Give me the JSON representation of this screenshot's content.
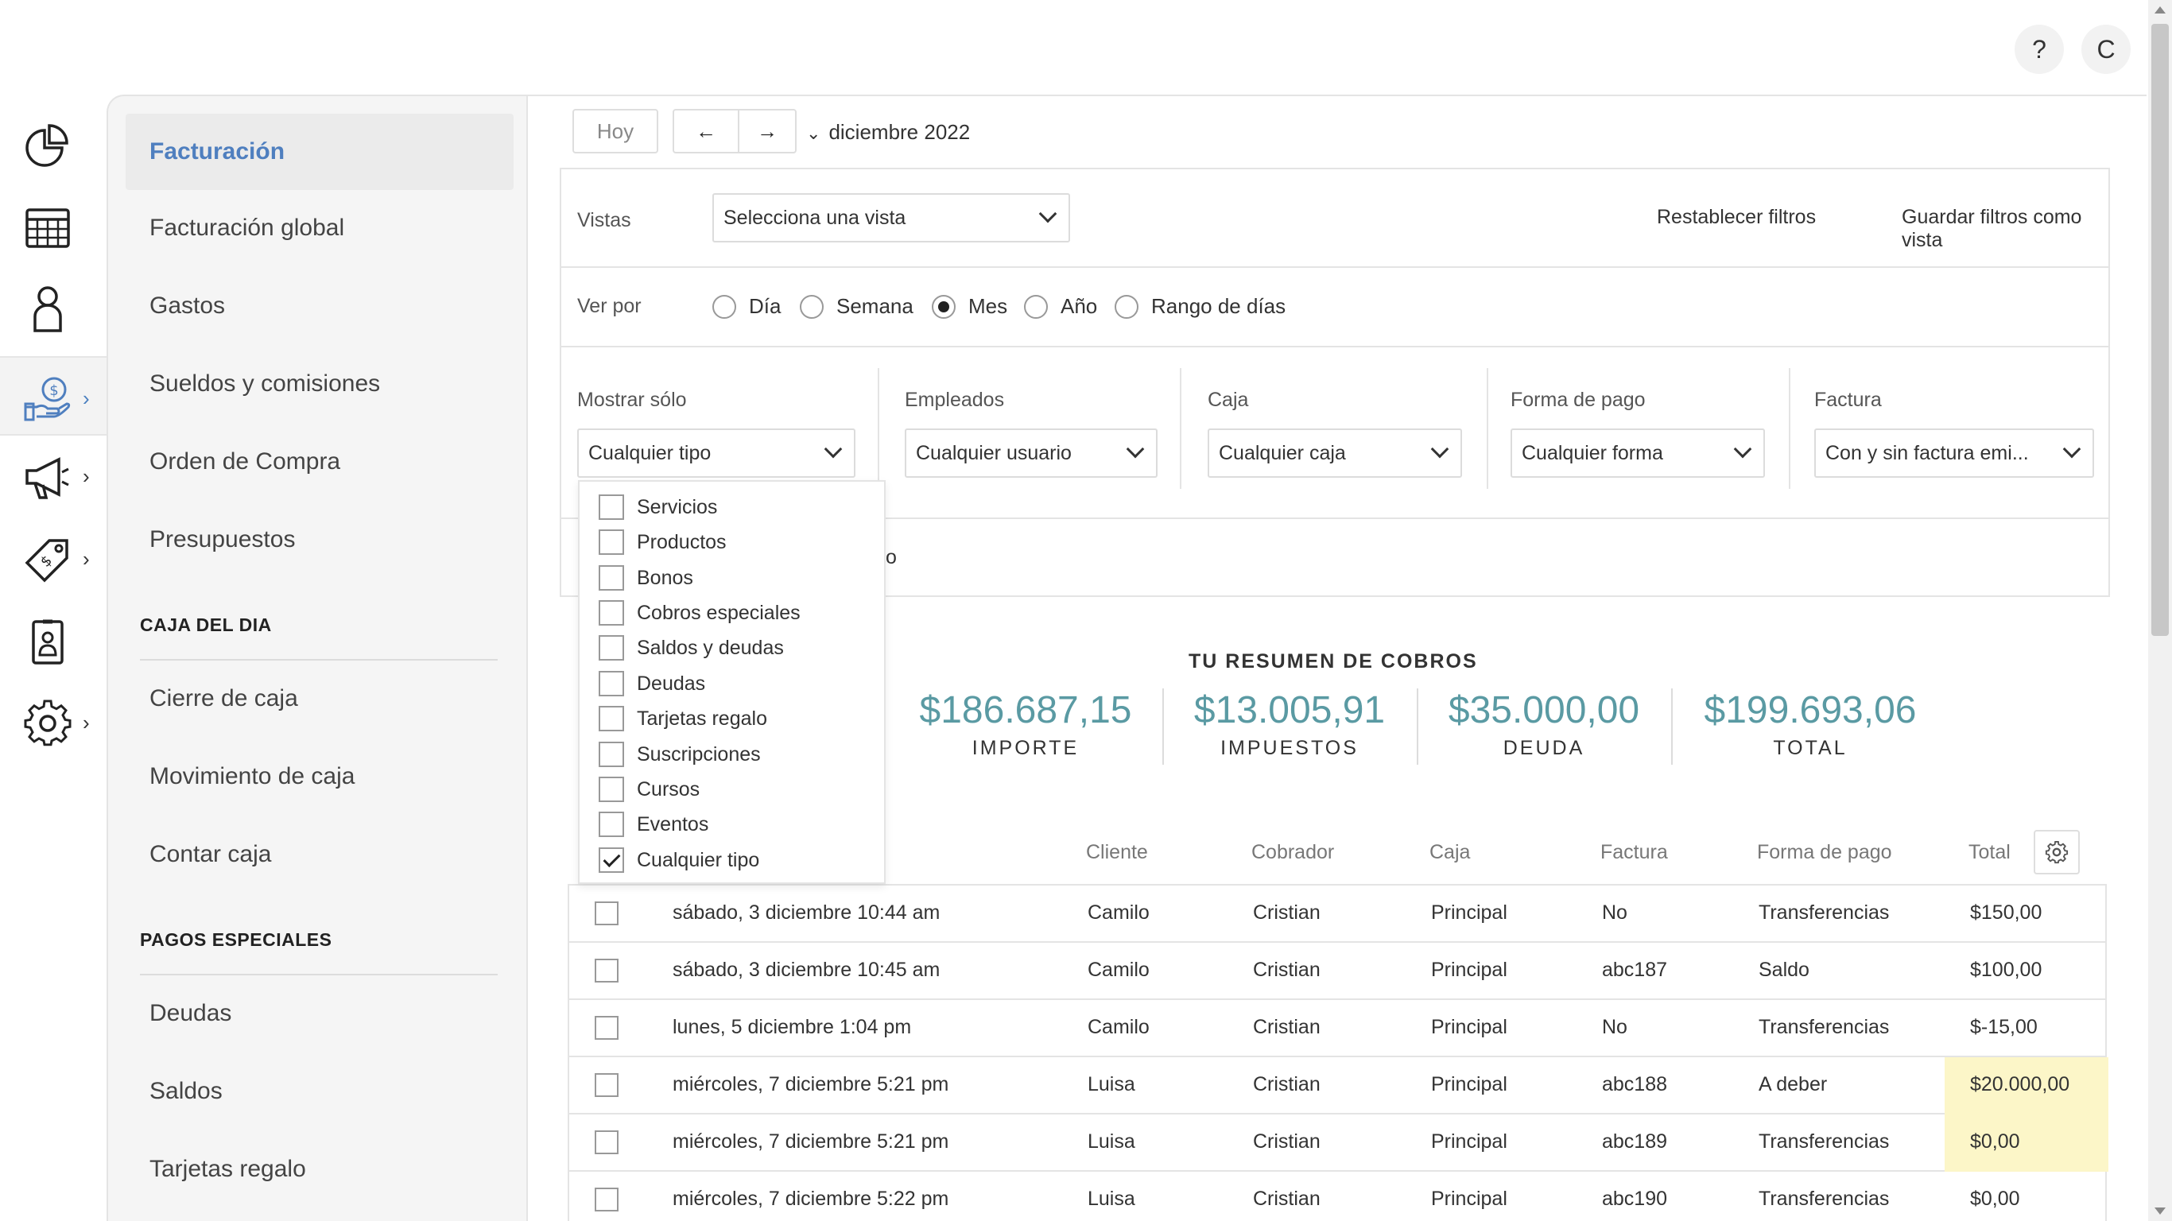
{
  "header": {
    "help_label": "?",
    "user_initial": "C"
  },
  "rail": {
    "items": [
      {
        "icon": "pie-chart-icon"
      },
      {
        "icon": "calendar-icon"
      },
      {
        "icon": "user-icon"
      },
      {
        "icon": "money-hand-icon",
        "active": true
      },
      {
        "icon": "megaphone-icon"
      },
      {
        "icon": "tag-icon"
      },
      {
        "icon": "badge-icon"
      },
      {
        "icon": "gear-icon"
      }
    ],
    "chevron": "›"
  },
  "sidebar": {
    "items": [
      {
        "label": "Facturación"
      },
      {
        "label": "Facturación global"
      },
      {
        "label": "Gastos"
      },
      {
        "label": "Sueldos y comisiones"
      },
      {
        "label": "Orden de Compra"
      },
      {
        "label": "Presupuestos"
      }
    ],
    "section_caja": "CAJA DEL DIA",
    "caja_items": [
      {
        "label": "Cierre de caja"
      },
      {
        "label": "Movimiento de caja"
      },
      {
        "label": "Contar caja"
      }
    ],
    "section_pagos": "PAGOS ESPECIALES",
    "pagos_items": [
      {
        "label": "Deudas"
      },
      {
        "label": "Saldos"
      },
      {
        "label": "Tarjetas regalo"
      }
    ]
  },
  "toolbar": {
    "today": "Hoy",
    "prev": "←",
    "next": "→",
    "caret": "⌄",
    "month": "diciembre 2022"
  },
  "filters": {
    "views_label": "Vistas",
    "views_value": "Selecciona una vista",
    "reset": "Restablecer filtros",
    "save_view": "Guardar filtros como vista",
    "view_by_label": "Ver por",
    "view_by_options": [
      {
        "label": "Día",
        "selected": false
      },
      {
        "label": "Semana",
        "selected": false
      },
      {
        "label": "Mes",
        "selected": true
      },
      {
        "label": "Año",
        "selected": false
      },
      {
        "label": "Rango de días",
        "selected": false
      }
    ],
    "show_only_label": "Mostrar sólo",
    "show_only_value": "Cualquier tipo",
    "employees_label": "Empleados",
    "employees_value": "Cualquier usuario",
    "cash_label": "Caja",
    "cash_value": "Cualquier caja",
    "payment_label": "Forma de pago",
    "payment_value": "Cualquier forma",
    "invoice_label": "Factura",
    "invoice_value": "Con y sin factura emi...",
    "partial_text": "o"
  },
  "type_dropdown": {
    "options": [
      {
        "label": "Servicios",
        "checked": false
      },
      {
        "label": "Productos",
        "checked": false
      },
      {
        "label": "Bonos",
        "checked": false
      },
      {
        "label": "Cobros especiales",
        "checked": false
      },
      {
        "label": "Saldos y deudas",
        "checked": false
      },
      {
        "label": "Deudas",
        "checked": false
      },
      {
        "label": "Tarjetas regalo",
        "checked": false
      },
      {
        "label": "Suscripciones",
        "checked": false
      },
      {
        "label": "Cursos",
        "checked": false
      },
      {
        "label": "Eventos",
        "checked": false
      },
      {
        "label": "Cualquier tipo",
        "checked": true
      }
    ]
  },
  "summary": {
    "title": "TU RESUMEN DE COBROS",
    "stats": [
      {
        "value": "$186.687,15",
        "label": "IMPORTE"
      },
      {
        "value": "$13.005,91",
        "label": "IMPUESTOS"
      },
      {
        "value": "$35.000,00",
        "label": "DEUDA"
      },
      {
        "value": "$199.693,06",
        "label": "TOTAL"
      }
    ]
  },
  "table": {
    "headers": [
      "Cliente",
      "Cobrador",
      "Caja",
      "Factura",
      "Forma de pago",
      "Total"
    ],
    "highlight_color": "#fcf6c8",
    "rows": [
      {
        "date": "sábado, 3 diciembre 10:44 am",
        "client": "Camilo",
        "collector": "Cristian",
        "cash": "Principal",
        "invoice": "No",
        "payment": "Transferencias",
        "total": "$150,00",
        "highlight": false
      },
      {
        "date": "sábado, 3 diciembre 10:45 am",
        "client": "Camilo",
        "collector": "Cristian",
        "cash": "Principal",
        "invoice": "abc187",
        "payment": "Saldo",
        "total": "$100,00",
        "highlight": false
      },
      {
        "date": "lunes, 5 diciembre 1:04 pm",
        "client": "Camilo",
        "collector": "Cristian",
        "cash": "Principal",
        "invoice": "No",
        "payment": "Transferencias",
        "total": "$-15,00",
        "highlight": false
      },
      {
        "date": "miércoles, 7 diciembre 5:21 pm",
        "client": "Luisa",
        "collector": "Cristian",
        "cash": "Principal",
        "invoice": "abc188",
        "payment": "A deber",
        "total": "$20.000,00",
        "highlight": true
      },
      {
        "date": "miércoles, 7 diciembre 5:21 pm",
        "client": "Luisa",
        "collector": "Cristian",
        "cash": "Principal",
        "invoice": "abc189",
        "payment": "Transferencias",
        "total": "$0,00",
        "highlight": true
      },
      {
        "date": "miércoles, 7 diciembre 5:22 pm",
        "client": "Luisa",
        "collector": "Cristian",
        "cash": "Principal",
        "invoice": "abc190",
        "payment": "Transferencias",
        "total": "$0,00",
        "highlight": false
      }
    ]
  },
  "colors": {
    "accent": "#4f7fbf",
    "stat_value": "#5a9aa3"
  }
}
